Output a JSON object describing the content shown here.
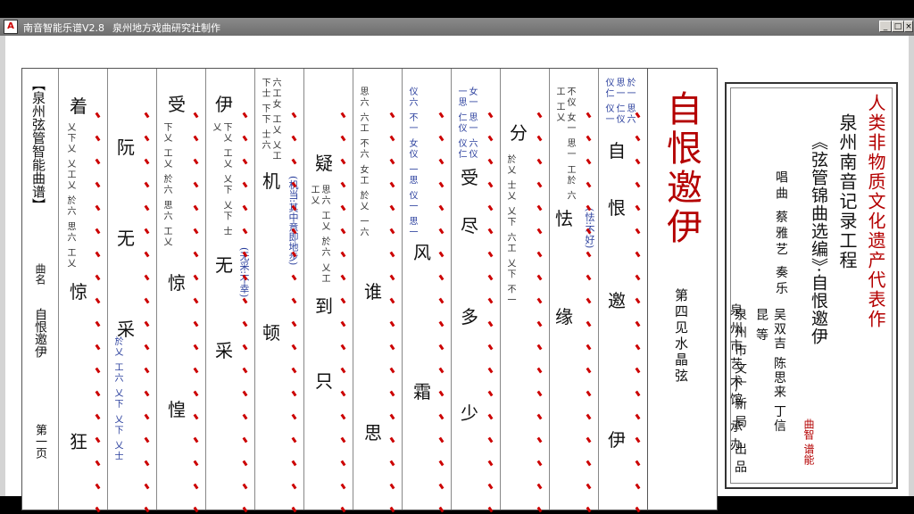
{
  "window": {
    "title": "南音智能乐谱V2.8",
    "credit": "泉州地方戏曲研究社制作",
    "buttons": {
      "minimize": "_",
      "maximize": "□",
      "close": "×"
    },
    "icon_label": "A"
  },
  "left_margin": {
    "book_title": "【泉州弦管智能曲谱】",
    "label_qu": "曲名",
    "song_name": "自恨邀伊",
    "page": "第一页"
  },
  "title_column": {
    "title": "自恨邀伊",
    "subtitle": "第四见水晶弦"
  },
  "columns": [
    {
      "lyrics": [
        "着",
        "惊",
        "狂"
      ],
      "notation": "乂下乂 乂工乂 於六 思六 工乂"
    },
    {
      "lyrics": [
        "阮",
        "无",
        "采"
      ],
      "notation": "於乂 工六 乂下 乂下 乂士"
    },
    {
      "lyrics": [
        "受",
        "惊",
        "惶"
      ],
      "notation": "下乂 工乂 於六 思六 工乂"
    },
    {
      "lyrics": [
        "伊",
        "无",
        "采"
      ],
      "notation": "下乂 工乂 乂下 乂下 士乂"
    },
    {
      "lyrics": [
        "机",
        "顿"
      ],
      "notation": "六工女 工乂 乂工 下士 下下 士六"
    },
    {
      "lyrics": [
        "疑",
        "到",
        "只"
      ],
      "notation": "思六 工乂 於六 乂工 工乂"
    },
    {
      "lyrics": [
        "谁",
        "思"
      ],
      "notation": "思六 六工 不六 女工 於乂 一六"
    },
    {
      "lyrics": [
        "风",
        "霜"
      ],
      "notation": "仪六 不一 女仪 一思 仪一 思一"
    },
    {
      "lyrics": [
        "受",
        "尽",
        "多",
        "少"
      ],
      "notation": "女一 思一 六仪 一思 仁仪 仪仁"
    },
    {
      "lyrics": [
        "分"
      ],
      "notation": "於乂 士乂 乂下 六工 乂下 不一"
    },
    {
      "lyrics": [
        "怯",
        "缘"
      ],
      "notation": "不仪 女一 思一 工於 六工 工乂"
    },
    {
      "lyrics": [
        "自",
        "恨",
        "邀",
        "伊"
      ],
      "notation": "於一 思六 思一 仁仪 仪仁 仪一"
    }
  ],
  "annotations": [
    {
      "text": "(怯:不好)"
    },
    {
      "text": "(无采:不幸)"
    },
    {
      "text": "(机当:其中意即地步)"
    }
  ],
  "cover": {
    "heritage": "人类非物质文化遗产代表作",
    "project": "泉州南音记录工程",
    "series": "《弦管锦曲选编》·自恨邀伊",
    "performer_label": "唱曲 蔡雅艺 奏乐",
    "musicians": "吴双吉 陈思来 丁信昆 等",
    "publisher": "泉州市文广新局 出品",
    "organizer": "泉州市艺术馆 承办",
    "stamp": "曲智 谱能"
  },
  "colors": {
    "accent_red": "#b40000",
    "notation_blue": "#2a3f9d",
    "tick_red": "#c00000"
  }
}
